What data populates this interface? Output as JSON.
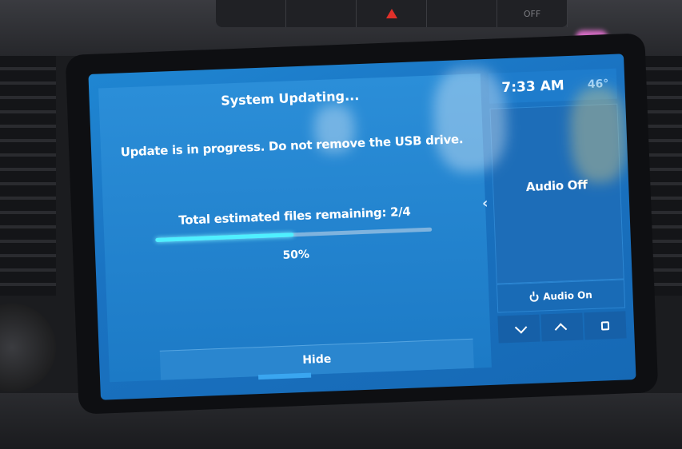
{
  "dashboard": {
    "buttons": [
      "",
      "",
      "",
      "",
      "OFF"
    ]
  },
  "dialog": {
    "title": "System Updating...",
    "message": "Update is in progress. Do not remove the USB drive.",
    "progress_label": "Total estimated files remaining: 2/4",
    "progress_value": 0.5,
    "progress_percent": "50%",
    "hide_label": "Hide"
  },
  "side_panel": {
    "time": "7:33 AM",
    "temperature": "46°",
    "audio_status": "Audio Off",
    "audio_on_label": "Audio On"
  },
  "colors": {
    "screen_bg": "#1a73c2",
    "progress_fill": "#4ff0ff",
    "progress_track": "#7fb3de"
  }
}
